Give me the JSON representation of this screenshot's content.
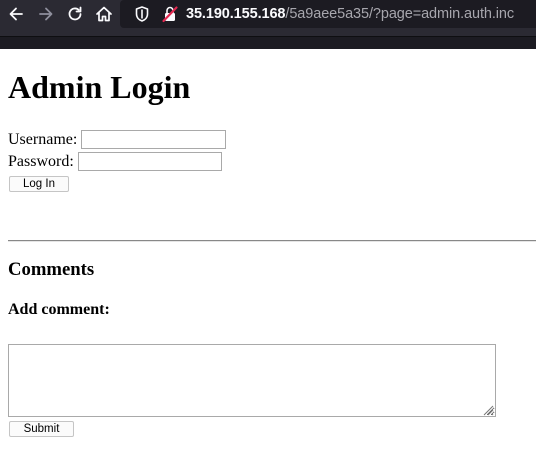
{
  "browser": {
    "url_host": "35.190.155.168",
    "url_path": "/5a9aee5a35/?page=admin.auth.inc",
    "icons": [
      "back-icon",
      "forward-icon",
      "reload-icon",
      "home-icon",
      "tracking-protection-icon",
      "insecure-connection-icon"
    ]
  },
  "page": {
    "title": "Admin Login",
    "username_label": "Username:",
    "username_value": "",
    "password_label": "Password:",
    "password_value": "",
    "login_button": "Log In",
    "comments_heading": "Comments",
    "add_comment_heading": "Add comment:",
    "comment_value": "",
    "submit_button": "Submit"
  }
}
